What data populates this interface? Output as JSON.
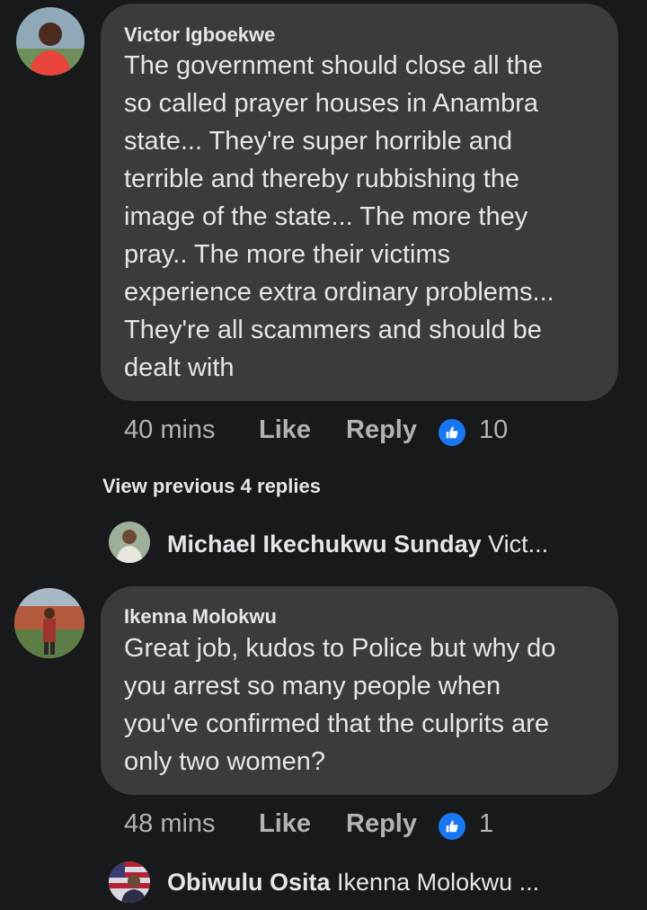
{
  "comments": [
    {
      "author": "Victor Igboekwe",
      "text": "The government should close all the\nso called prayer houses in Anambra\nstate... They're super horrible and\nterrible and thereby rubbishing the\nimage of the state... The more they\npray.. The more their victims\nexperience extra ordinary problems...\nThey're all scammers and should be\ndealt with",
      "time": "40 mins",
      "like_label": "Like",
      "reply_label": "Reply",
      "reactions": "10",
      "avatar_icon": "user-avatar-red-shirt",
      "view_previous": "View previous 4 replies",
      "reply_preview": {
        "name": "Michael Ikechukwu Sunday",
        "snippet": "Vict...",
        "avatar_icon": "user-avatar"
      }
    },
    {
      "author": "Ikenna Molokwu",
      "text": "Great job, kudos to Police but why do\nyou arrest so many people when\nyou've confirmed that the culprits are\nonly two women?",
      "time": "48 mins",
      "like_label": "Like",
      "reply_label": "Reply",
      "reactions": "1",
      "avatar_icon": "user-avatar-standing",
      "reply_preview": {
        "name": "Obiwulu Osita",
        "snippet": "Ikenna Molokwu ...",
        "avatar_icon": "user-avatar-flag"
      }
    }
  ],
  "colors": {
    "background": "#18191a",
    "bubble": "#3a3b3c",
    "like_blue": "#1877f2",
    "meta": "#b0b3b8"
  }
}
